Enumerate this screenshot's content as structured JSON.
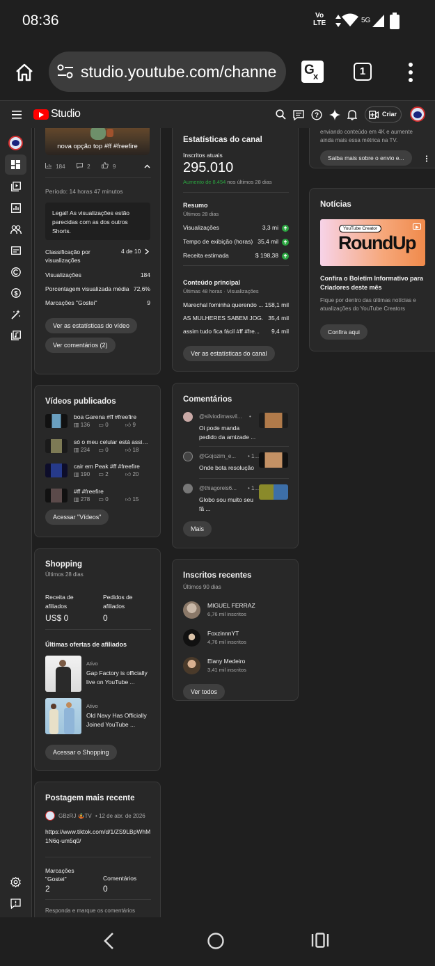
{
  "statusbar": {
    "time": "08:36",
    "net_top": "Vo",
    "net_bottom": "LTE",
    "five_g": "5G"
  },
  "browser": {
    "url": "studio.youtube.com/channe",
    "tab_count": "1"
  },
  "header": {
    "logo_text": "Studio",
    "create_label": "Criar"
  },
  "video_card": {
    "thumb_title": "nova opção top #ff #freefire",
    "views": "184",
    "comments": "2",
    "likes": "9",
    "period": "Período: 14 horas 47 minutos",
    "tip": "Legal! As visualizações estão parecidas com as dos outros Shorts.",
    "rank_label": "Classificação por visualizações",
    "rank_value": "4 de 10",
    "rows": [
      {
        "label": "Visualizações",
        "value": "184"
      },
      {
        "label": "Porcentagem visualizada média",
        "value": "72,6%"
      },
      {
        "label": "Marcações \"Gostei\"",
        "value": "9"
      }
    ],
    "btn_stats": "Ver as estatísticas do vídeo",
    "btn_comments": "Ver comentários (2)"
  },
  "channel_stats": {
    "title": "Estatísticas do canal",
    "subs_label": "Inscritos atuais",
    "subs_value": "295.010",
    "growth_green": "Aumento de 8.454",
    "growth_rest": "nos últimos 28 dias",
    "summary_title": "Resumo",
    "summary_sub": "Últimos 28 dias",
    "summary_rows": [
      {
        "label": "Visualizações",
        "value": "3,3 mi"
      },
      {
        "label": "Tempo de exibição (horas)",
        "value": "35,4 mil"
      },
      {
        "label": "Receita estimada",
        "value": "$ 198,38"
      }
    ],
    "top_title": "Conteúdo principal",
    "top_sub": "Últimas 48 horas · Visualizações",
    "top_rows": [
      {
        "label": "Marechal fominha querendo ...",
        "value": "158,1 mil"
      },
      {
        "label": "AS MULHERES SABEM JOG...",
        "value": "35,4 mil"
      },
      {
        "label": "assim tudo fica fácil #ff #fre...",
        "value": "9,4 mil"
      }
    ],
    "button": "Ver as estatísticas do canal"
  },
  "tip_card": {
    "text": "enviando conteúdo em 4K e aumente ainda mais essa métrica na TV.",
    "button": "Saiba mais sobre o envio e..."
  },
  "news": {
    "title": "Notícias",
    "banner_pill": "YouTube Creator",
    "banner_text": "RoundUp",
    "headline": "Confira o Boletim Informativo para Criadores deste mês",
    "desc": "Fique por dentro das últimas notícias e atualizações do YouTube Creators",
    "button": "Confira aqui"
  },
  "published": {
    "title": "Vídeos publicados",
    "items": [
      {
        "title": "boa Garena #ff #freefire",
        "views": "136",
        "comments": "0",
        "likes": "9"
      },
      {
        "title": "só o meu celular está assim...",
        "views": "234",
        "comments": "0",
        "likes": "18"
      },
      {
        "title": "cair em Peak #ff #freefire",
        "views": "190",
        "comments": "2",
        "likes": "20"
      },
      {
        "title": "#ff #freefire",
        "views": "278",
        "comments": "0",
        "likes": "15"
      }
    ],
    "button": "Acessar \"Vídeos\""
  },
  "comments": {
    "title": "Comentários",
    "items": [
      {
        "author": "@silviodimasvil...",
        "meta": "•",
        "text": "Oi pode manda pedido da amizade ..."
      },
      {
        "author": "@Gojozim_e...",
        "meta": "• 1...",
        "text": "Onde bota resolução"
      },
      {
        "author": "@thiagoreis6...",
        "meta": "• 1...",
        "text": "Globo sou muito seu fã ..."
      }
    ],
    "button": "Mais"
  },
  "shopping": {
    "title": "Shopping",
    "sub": "Últimos 28 dias",
    "rev_label": "Receita de afiliados",
    "rev_value": "US$ 0",
    "orders_label": "Pedidos de afiliados",
    "orders_value": "0",
    "offers_title": "Últimas ofertas de afiliados",
    "offers": [
      {
        "status": "Ativo",
        "text": "Gap Factory is officially live on YouTube ..."
      },
      {
        "status": "Ativo",
        "text": "Old Navy Has Officially Joined YouTube ..."
      }
    ],
    "button": "Acessar o Shopping"
  },
  "subscribers": {
    "title": "Inscritos recentes",
    "sub": "Últimos 90 dias",
    "items": [
      {
        "name": "MIGUEL FERRAZ",
        "count": "6,76 mil inscritos"
      },
      {
        "name": "FoxzinnnYT",
        "count": "4,76 mil inscritos"
      },
      {
        "name": "Elany Medeiro",
        "count": "3,41 mil inscritos"
      }
    ],
    "button": "Ver todos"
  },
  "post": {
    "title": "Postagem mais recente",
    "channel": "GBzRJ 🤹TV",
    "date": "• 12 de abr. de 2026",
    "link": "https://www.tiktok.com/d/1/ZS9LBpWhM1N6q-um5q0/",
    "likes_label": "Marcações \"Gostei\"",
    "likes_value": "2",
    "comments_label": "Comentários",
    "comments_value": "0",
    "footer": "Responda e marque os comentários"
  }
}
